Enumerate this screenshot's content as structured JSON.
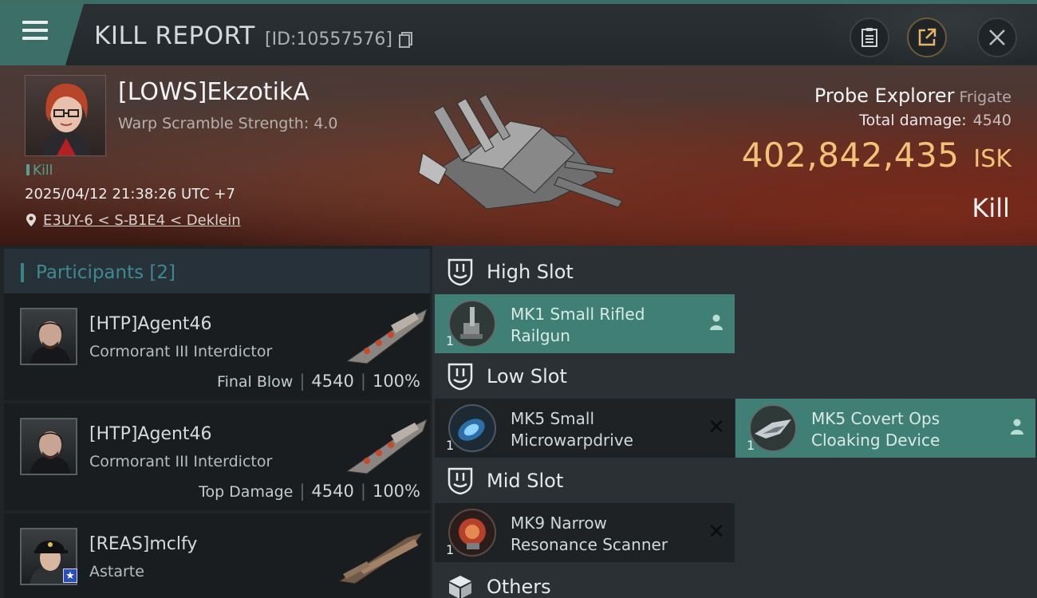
{
  "header": {
    "title": "KILL REPORT",
    "report_id": "[ID:10557576]"
  },
  "victim": {
    "name": "[LOWS]EkzotikA",
    "stat": "Warp Scramble Strength: 4.0",
    "tag": "Kill",
    "timestamp": "2025/04/12 21:38:26 UTC +7",
    "location": "E3UY-6 < S-B1E4 < Deklein"
  },
  "target": {
    "ship": "Probe Explorer",
    "ship_class": "Frigate",
    "total_damage_label": "Total damage:",
    "total_damage": "4540",
    "isk_value": "402,842,435",
    "isk_unit": "ISK",
    "result": "Kill"
  },
  "participants": {
    "label": "Participants",
    "count": "[2]",
    "rows": [
      {
        "name": "[HTP]Agent46",
        "ship": "Cormorant III Interdictor",
        "role": "Final Blow",
        "damage": "4540",
        "percent": "100%"
      },
      {
        "name": "[HTP]Agent46",
        "ship": "Cormorant III Interdictor",
        "role": "Top Damage",
        "damage": "4540",
        "percent": "100%"
      },
      {
        "name": "[REAS]mclfy",
        "ship": "Astarte"
      }
    ]
  },
  "fitting": {
    "high_slot": {
      "label": "High Slot",
      "modules": [
        {
          "name_line1": "MK1 Small Rifled",
          "name_line2": "Railgun",
          "qty": "1"
        }
      ]
    },
    "low_slot": {
      "label": "Low Slot",
      "modules": [
        {
          "name_line1": "MK5 Small",
          "name_line2": "Microwarpdrive",
          "qty": "1"
        },
        {
          "name_line1": "MK5 Covert Ops",
          "name_line2": "Cloaking Device",
          "qty": "1"
        }
      ]
    },
    "mid_slot": {
      "label": "Mid Slot",
      "modules": [
        {
          "name_line1": "MK9 Narrow",
          "name_line2": "Resonance Scanner",
          "qty": "1"
        }
      ]
    },
    "others": {
      "label": "Others"
    }
  },
  "colors": {
    "accent_teal": "#3c6f67",
    "isk_gold": "#f3c277",
    "participants_title": "#3f8a90"
  },
  "icons": [
    "menu-icon",
    "copy-icon",
    "clipboard-icon",
    "share-icon",
    "close-icon",
    "location-pin-icon",
    "shield-slot-icon",
    "pilot-icon",
    "remove-x-icon",
    "cube-icon"
  ]
}
